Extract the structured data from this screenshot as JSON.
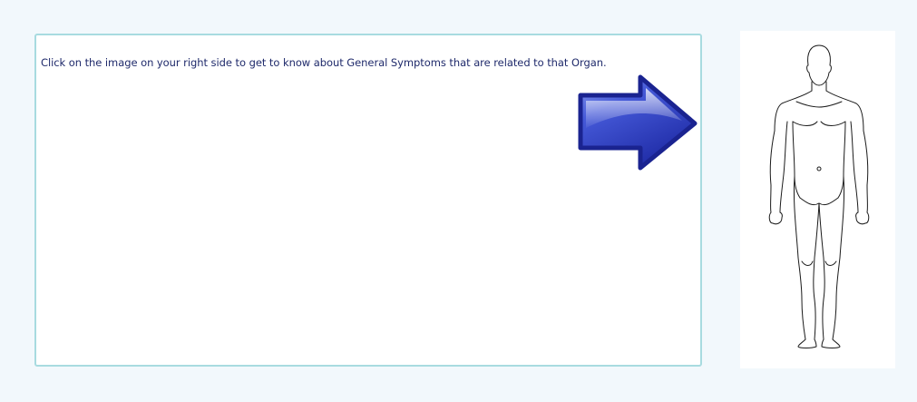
{
  "instruction": {
    "text": "Click on the image on your right side to get to know about General Symptoms that are related to that Organ."
  },
  "arrow": {
    "icon": "arrow-right-icon",
    "color": "#2b3bb8"
  },
  "body_image": {
    "icon": "human-body-front-icon"
  },
  "colors": {
    "background": "#f2f8fc",
    "panel_border": "#a8dbe0",
    "text": "#1f2a6b"
  }
}
